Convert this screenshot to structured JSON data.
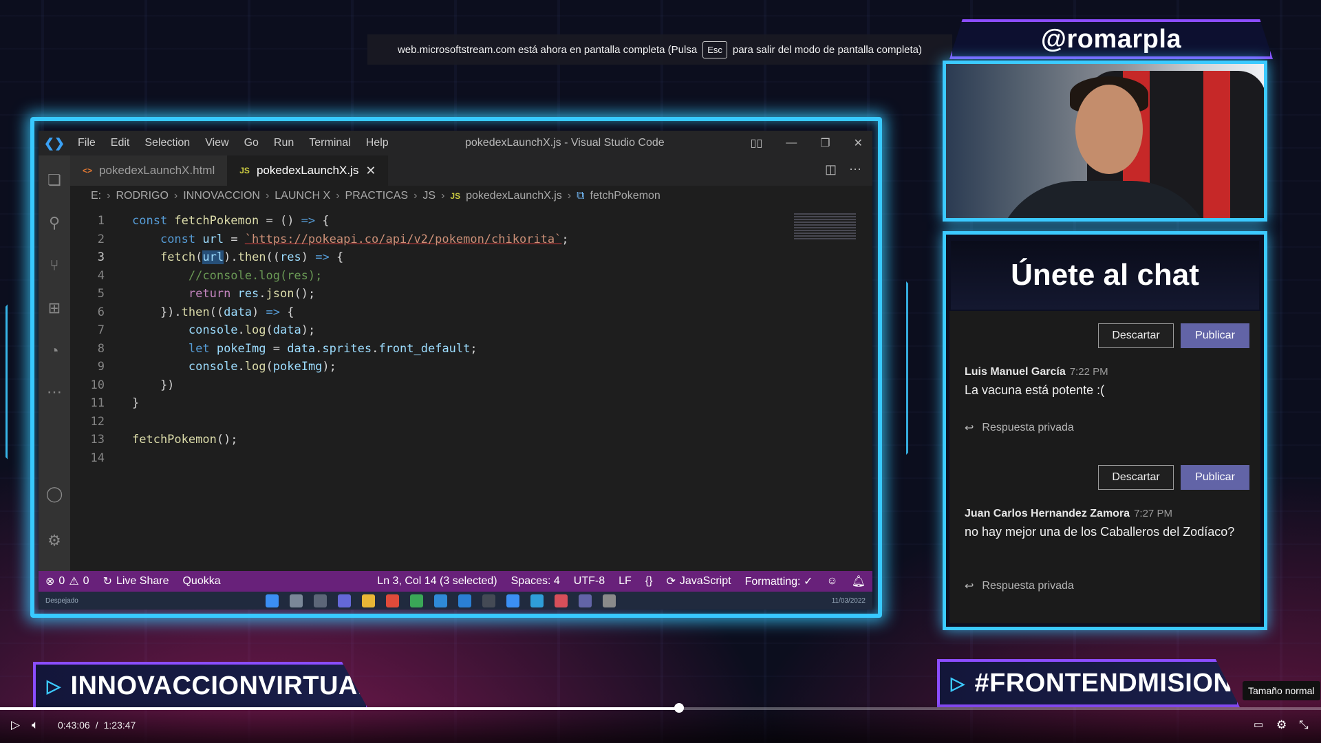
{
  "fullscreen_notice": {
    "before": "web.microsoftstream.com está ahora en pantalla completa (Pulsa",
    "key": "Esc",
    "after": "para salir del modo de pantalla completa)"
  },
  "vscode": {
    "menu": [
      "File",
      "Edit",
      "Selection",
      "View",
      "Go",
      "Run",
      "Terminal",
      "Help"
    ],
    "window_title": "pokedexLaunchX.js - Visual Studio Code",
    "tabs": [
      {
        "icon": "<>",
        "label": "pokedexLaunchX.html"
      },
      {
        "icon": "JS",
        "label": "pokedexLaunchX.js"
      }
    ],
    "breadcrumb": [
      "E:",
      "RODRIGO",
      "INNOVACCION",
      "LAUNCH X",
      "PRACTICAS",
      "JS"
    ],
    "breadcrumb_js": "JS",
    "breadcrumb_file": "pokedexLaunchX.js",
    "breadcrumb_symbol": "fetchPokemon",
    "code_lines": [
      {
        "n": "1",
        "tokens": [
          [
            "k",
            "const "
          ],
          [
            "fn",
            "fetchPokemon"
          ],
          [
            "p",
            " = () "
          ],
          [
            "k",
            "=>"
          ],
          [
            "p",
            " {"
          ]
        ]
      },
      {
        "n": "2",
        "tokens": [
          [
            "p",
            "    "
          ],
          [
            "k",
            "const "
          ],
          [
            "v",
            "url"
          ],
          [
            "p",
            " = "
          ],
          [
            "s",
            "`https://pokeapi.co/api/v2/pokemon/chikorita`"
          ],
          [
            "p",
            ";"
          ]
        ]
      },
      {
        "n": "3",
        "tokens": [
          [
            "p",
            "    "
          ],
          [
            "fn",
            "fetch"
          ],
          [
            "p",
            "("
          ],
          [
            "vsel",
            "url"
          ],
          [
            "p",
            ")."
          ],
          [
            "fn",
            "then"
          ],
          [
            "p",
            "(("
          ],
          [
            "v",
            "res"
          ],
          [
            "p",
            ") "
          ],
          [
            "k",
            "=>"
          ],
          [
            "p",
            " {"
          ]
        ]
      },
      {
        "n": "4",
        "tokens": [
          [
            "p",
            "        "
          ],
          [
            "c",
            "//console.log(res);"
          ]
        ]
      },
      {
        "n": "5",
        "tokens": [
          [
            "p",
            "        "
          ],
          [
            "ctl",
            "return "
          ],
          [
            "v",
            "res"
          ],
          [
            "p",
            "."
          ],
          [
            "fn",
            "json"
          ],
          [
            "p",
            "();"
          ]
        ]
      },
      {
        "n": "6",
        "tokens": [
          [
            "p",
            "    })."
          ],
          [
            "fn",
            "then"
          ],
          [
            "p",
            "(("
          ],
          [
            "v",
            "data"
          ],
          [
            "p",
            ") "
          ],
          [
            "k",
            "=>"
          ],
          [
            "p",
            " {"
          ]
        ]
      },
      {
        "n": "7",
        "tokens": [
          [
            "p",
            "        "
          ],
          [
            "v",
            "console"
          ],
          [
            "p",
            "."
          ],
          [
            "fn",
            "log"
          ],
          [
            "p",
            "("
          ],
          [
            "v",
            "data"
          ],
          [
            "p",
            ");"
          ]
        ]
      },
      {
        "n": "8",
        "tokens": [
          [
            "p",
            "        "
          ],
          [
            "k",
            "let "
          ],
          [
            "v",
            "pokeImg"
          ],
          [
            "p",
            " = "
          ],
          [
            "v",
            "data"
          ],
          [
            "p",
            "."
          ],
          [
            "v",
            "sprites"
          ],
          [
            "p",
            "."
          ],
          [
            "v",
            "front_default"
          ],
          [
            "p",
            ";"
          ]
        ]
      },
      {
        "n": "9",
        "tokens": [
          [
            "p",
            "        "
          ],
          [
            "v",
            "console"
          ],
          [
            "p",
            "."
          ],
          [
            "fn",
            "log"
          ],
          [
            "p",
            "("
          ],
          [
            "v",
            "pokeImg"
          ],
          [
            "p",
            ");"
          ]
        ]
      },
      {
        "n": "10",
        "tokens": [
          [
            "p",
            "    })"
          ]
        ]
      },
      {
        "n": "11",
        "tokens": [
          [
            "p",
            "}"
          ]
        ]
      },
      {
        "n": "12",
        "tokens": []
      },
      {
        "n": "13",
        "tokens": [
          [
            "fn",
            "fetchPokemon"
          ],
          [
            "p",
            "();"
          ]
        ]
      },
      {
        "n": "14",
        "tokens": []
      }
    ],
    "current_line": "3",
    "status": {
      "errors": "0",
      "warnings": "0",
      "live_share": "Live Share",
      "quokka": "Quokka",
      "position": "Ln 3, Col 14 (3 selected)",
      "spaces": "Spaces: 4",
      "encoding": "UTF-8",
      "eol": "LF",
      "braces": "{}",
      "language": "JavaScript",
      "formatting": "Formatting: ✓"
    },
    "taskbar": {
      "weather_label": "Despejado",
      "date": "11/03/2022"
    }
  },
  "stream": {
    "handle": "@romarpla",
    "chat_title": "Únete al chat",
    "discard_label": "Descartar",
    "publish_label": "Publicar",
    "reply_label": "Respuesta privada",
    "messages": [
      {
        "author": "Luis Manuel García",
        "time": "7:22 PM",
        "text": "La vacuna está potente :("
      },
      {
        "author": "Juan Carlos Hernandez Zamora",
        "time": "7:27 PM",
        "text": "no hay mejor una de los Caballeros del Zodíaco?"
      }
    ],
    "banner_left": "INNOVACCIONVIRTUAL",
    "banner_right": "#FRONTENDMISION"
  },
  "player": {
    "current_time": "0:43:06",
    "separator": "/",
    "duration": "1:23:47",
    "progress_fraction": 0.514,
    "tooltip": "Tamaño normal"
  },
  "colors": {
    "accent_cyan": "#38c9ff",
    "accent_purple": "#8b4dff",
    "vscode_status": "#68217a",
    "teams_publish": "#6264a7"
  }
}
